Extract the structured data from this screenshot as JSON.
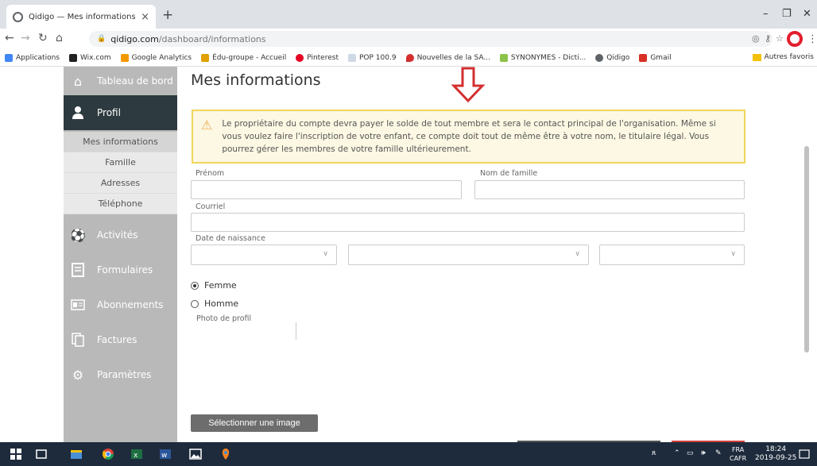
{
  "browser": {
    "tab_title": "Qidigo — Mes informations",
    "url_host": "qidigo.com",
    "url_path": "/dashboard/informations",
    "bookmarks": [
      {
        "label": "Applications",
        "color": "#4285f4"
      },
      {
        "label": "Wix.com",
        "color": "#222222"
      },
      {
        "label": "Google Analytics",
        "color": "#f29900"
      },
      {
        "label": "Édu-groupe - Accueil",
        "color": "#e0a100"
      },
      {
        "label": "Pinterest",
        "color": "#e60023"
      },
      {
        "label": "POP 100.9",
        "color": "#cfd8e3"
      },
      {
        "label": "Nouvelles de la SA...",
        "color": "#d32f2f"
      },
      {
        "label": "SYNONYMES - Dicti...",
        "color": "#8bc34a"
      },
      {
        "label": "Qidigo",
        "color": "#5f6368"
      },
      {
        "label": "Gmail",
        "color": "#d93025"
      }
    ],
    "other_bookmarks": "Autres favoris"
  },
  "sidebar": {
    "dashboard": "Tableau de bord",
    "profile": "Profil",
    "sub_items": [
      "Mes informations",
      "Famille",
      "Adresses",
      "Téléphone"
    ],
    "activities": "Activités",
    "forms": "Formulaires",
    "subscriptions": "Abonnements",
    "invoices": "Factures",
    "settings": "Paramètres"
  },
  "main": {
    "title": "Mes informations",
    "warning": "Le propriétaire du compte devra payer le solde de tout membre et sera le contact principal de l'organisation. Même si vous voulez faire l'inscription de votre enfant, ce compte doit tout de même être à votre nom, le titulaire légal. Vous pourrez gérer les membres de votre famille ultérieurement.",
    "first_name_label": "Prénom",
    "last_name_label": "Nom de famille",
    "email_label": "Courriel",
    "birthdate_label": "Date de naissance",
    "gender_female": "Femme",
    "gender_male": "Homme",
    "gender_selected": "Femme",
    "photo_label": "Photo de profil",
    "select_image_button": "Sélectionner une image"
  },
  "taskbar": {
    "lang_top": "FRA",
    "lang_bottom": "CAFR",
    "time": "18:24",
    "date": "2019-09-25"
  },
  "colors": {
    "sidebar_bg": "#b9b9b9",
    "sidebar_active": "#2d3a40",
    "warning_border": "#f0d55c",
    "warning_bg": "#fcf8e3",
    "arrow_red": "#d32f2f"
  }
}
